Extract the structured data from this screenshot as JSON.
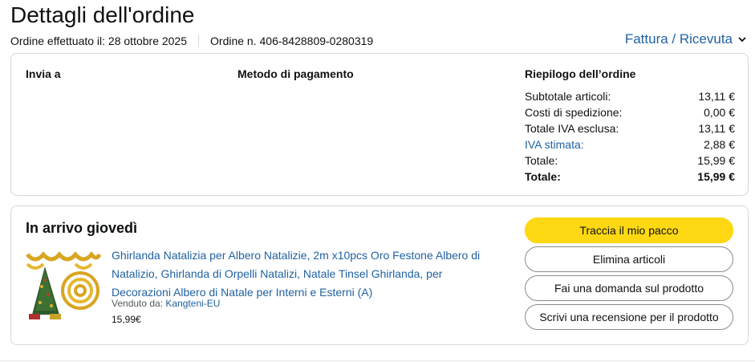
{
  "header": {
    "title": "Dettagli dell'ordine",
    "order_date": "Ordine effettuato il: 28 ottobre 2025",
    "order_number": "Ordine n. 406-8428809-0280319",
    "invoice_link": "Fattura / Ricevuta"
  },
  "details": {
    "ship_to_label": "Invia a",
    "payment_label": "Metodo di pagamento",
    "summary_label": "Riepilogo dell’ordine",
    "summary_rows": [
      {
        "label": "Subtotale articoli:",
        "value": "13,11 €"
      },
      {
        "label": "Costi di spedizione:",
        "value": "0,00 €"
      },
      {
        "label": "Totale IVA esclusa:",
        "value": "13,11 €"
      },
      {
        "label": "IVA stimata:",
        "value": "2,88 €"
      },
      {
        "label": "Totale:",
        "value": "15,99 €"
      },
      {
        "label": "Totale:",
        "value": "15,99 €"
      }
    ]
  },
  "shipment": {
    "status": "In arrivo giovedì",
    "product_title": "Ghirlanda Natalizia per Albero Natalizie, 2m x10pcs Oro Festone Albero di Natalizio, Ghirlanda di Orpelli Natalizi, Natale Tinsel Ghirlanda, per Decorazioni Albero di Natale per Interni e Esterni (A)",
    "seller_prefix": "Venduto da:",
    "seller_name": "Kangteni-EU",
    "price": "15,99€",
    "buttons": {
      "track": "Traccia il mio pacco",
      "remove": "Elimina articoli",
      "question": "Fai una domanda sul prodotto",
      "review": "Scrivi una recensione per il prodotto"
    }
  },
  "colors": {
    "link": "#2162a1",
    "primary_button": "#ffd814",
    "border": "#d5d9d9"
  }
}
